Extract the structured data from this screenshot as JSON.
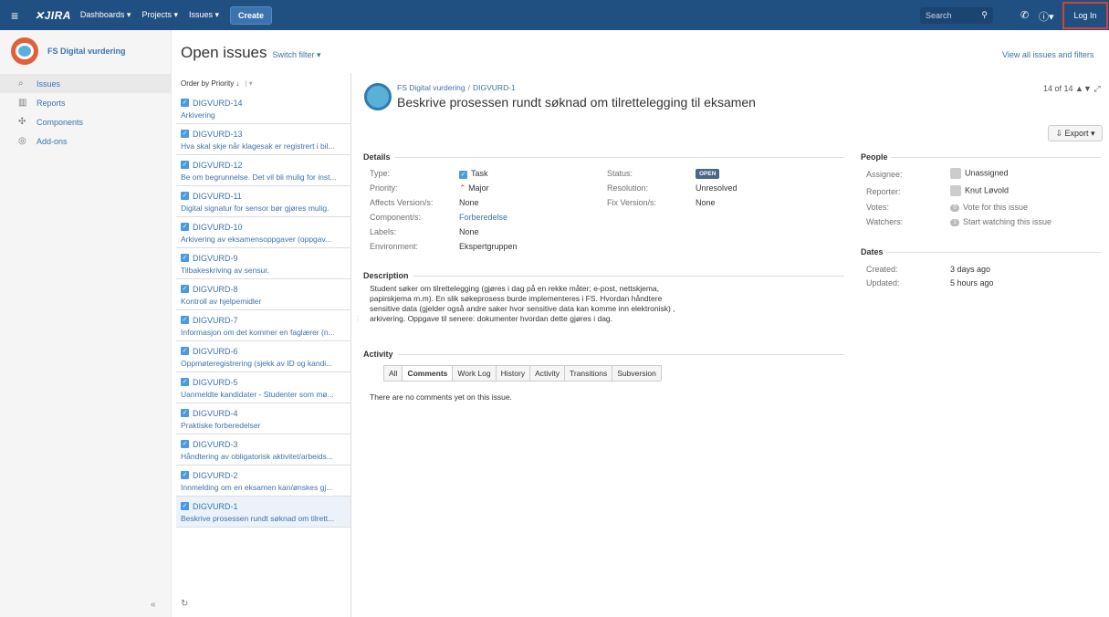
{
  "topbar": {
    "logo": "JIRA",
    "nav": [
      "Dashboards ▾",
      "Projects ▾",
      "Issues ▾"
    ],
    "create": "Create",
    "search_placeholder": "Search",
    "login": "Log In"
  },
  "sidebar": {
    "project": "FS Digital vurdering",
    "items": [
      {
        "label": "Issues"
      },
      {
        "label": "Reports"
      },
      {
        "label": "Components"
      },
      {
        "label": "Add-ons"
      }
    ],
    "collapse": "«"
  },
  "header": {
    "title": "Open issues",
    "switch": "Switch filter ▾",
    "view_all": "View all issues and filters"
  },
  "list": {
    "order": "Order by Priority ↓",
    "issues": [
      {
        "key": "DIGVURD-14",
        "summary": "Arkivering"
      },
      {
        "key": "DIGVURD-13",
        "summary": "Hva skal skje når klagesak er registrert i bil..."
      },
      {
        "key": "DIGVURD-12",
        "summary": "Be om begrunnelse. Det vil bli mulig for inst..."
      },
      {
        "key": "DIGVURD-11",
        "summary": "Digital signatur for sensor bør gjøres mulig."
      },
      {
        "key": "DIGVURD-10",
        "summary": "Arkivering av eksamensoppgaver (oppgav..."
      },
      {
        "key": "DIGVURD-9",
        "summary": "Tilbakeskriving av sensur."
      },
      {
        "key": "DIGVURD-8",
        "summary": "Kontroll av hjelpemidler"
      },
      {
        "key": "DIGVURD-7",
        "summary": "Informasjon om det kommer en faglærer (n..."
      },
      {
        "key": "DIGVURD-6",
        "summary": "Oppmøteregistrering (sjekk av ID og kandi..."
      },
      {
        "key": "DIGVURD-5",
        "summary": "Uanmeldte kandidater - Studenter som mø..."
      },
      {
        "key": "DIGVURD-4",
        "summary": "Praktiske forberedelser"
      },
      {
        "key": "DIGVURD-3",
        "summary": "Håndtering av obligatorisk aktivitet/arbeids..."
      },
      {
        "key": "DIGVURD-2",
        "summary": "Innmelding om en eksamen kan/ønskes gj..."
      },
      {
        "key": "DIGVURD-1",
        "summary": "Beskrive prosessen rundt søknad om tilrett..."
      }
    ]
  },
  "issue": {
    "project": "FS Digital vurdering",
    "key": "DIGVURD-1",
    "title": "Beskrive prosessen rundt søknad om tilrettelegging til eksamen",
    "pager": "14 of 14",
    "export": "Export ▾",
    "details_label": "Details",
    "type_label": "Type:",
    "type": "Task",
    "priority_label": "Priority:",
    "priority": "Major",
    "affects_label": "Affects Version/s:",
    "affects": "None",
    "components_label": "Component/s:",
    "components": "Forberedelse",
    "labels_label": "Labels:",
    "labels": "None",
    "env_label": "Environment:",
    "env": "Ekspertgruppen",
    "status_label": "Status:",
    "status": "OPEN",
    "resolution_label": "Resolution:",
    "resolution": "Unresolved",
    "fix_label": "Fix Version/s:",
    "fix": "None",
    "description_label": "Description",
    "description": "Student søker om tilrettelegging (gjøres i dag på en rekke måter; e-post, nettskjema, papirskjema m.m). En slik søkeprosess burde implementeres i FS. Hvordan håndtere sensitive data (gjelder også andre saker hvor sensitive data kan komme inn elektronisk) , arkivering. Oppgave til senere: dokumenter hvordan dette gjøres i dag.",
    "activity_label": "Activity",
    "tabs": [
      "All",
      "Comments",
      "Work Log",
      "History",
      "Activity",
      "Transitions",
      "Subversion"
    ],
    "no_comments": "There are no comments yet on this issue."
  },
  "people": {
    "label": "People",
    "assignee_label": "Assignee:",
    "assignee": "Unassigned",
    "reporter_label": "Reporter:",
    "reporter": "Knut Løvold",
    "votes_label": "Votes:",
    "votes_count": "0",
    "votes": "Vote for this issue",
    "watchers_label": "Watchers:",
    "watchers_count": "1",
    "watchers": "Start watching this issue"
  },
  "dates": {
    "label": "Dates",
    "created_label": "Created:",
    "created": "3 days ago",
    "updated_label": "Updated:",
    "updated": "5 hours ago"
  }
}
